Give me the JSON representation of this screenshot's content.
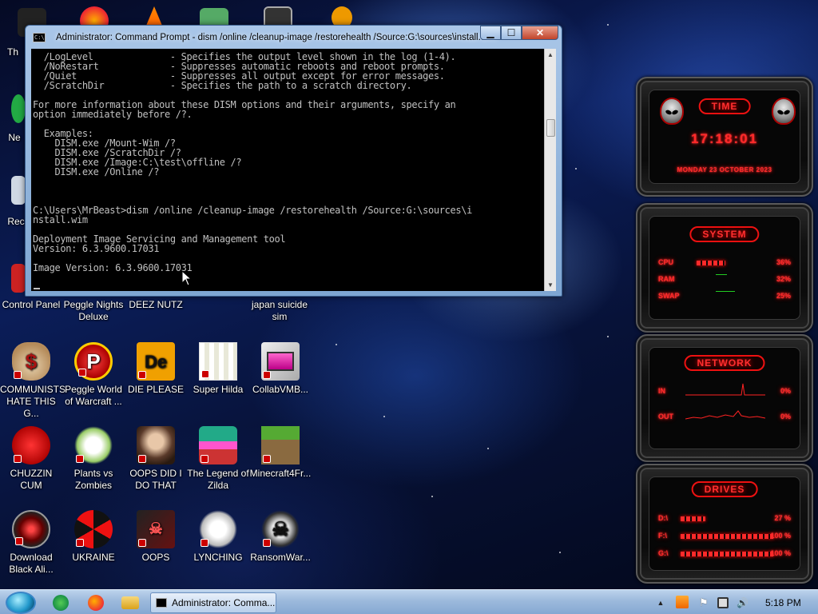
{
  "window": {
    "title": "Administrator: Command Prompt - dism  /online /cleanup-image /restorehealth /Source:G:\\sources\\install.wim",
    "console_lines": [
      "  /LogLevel              - Specifies the output level shown in the log (1-4).",
      "  /NoRestart             - Suppresses automatic reboots and reboot prompts.",
      "  /Quiet                 - Suppresses all output except for error messages.",
      "  /ScratchDir            - Specifies the path to a scratch directory.",
      "",
      "For more information about these DISM options and their arguments, specify an",
      "option immediately before /?.",
      "",
      "  Examples:",
      "    DISM.exe /Mount-Wim /?",
      "    DISM.exe /ScratchDir /?",
      "    DISM.exe /Image:C:\\test\\offline /?",
      "    DISM.exe /Online /?",
      "",
      "",
      "",
      "C:\\Users\\MrBeast>dism /online /cleanup-image /restorehealth /Source:G:\\sources\\i",
      "nstall.wim",
      "",
      "Deployment Image Servicing and Management tool",
      "Version: 6.3.9600.17031",
      "",
      "Image Version: 6.3.9600.17031"
    ]
  },
  "desktop": {
    "partial_labels": {
      "top_left": "Th",
      "ne": "Ne",
      "re": "Rec"
    },
    "icons": [
      {
        "label": "Control Panel",
        "icon": "control-panel-icon"
      },
      {
        "label": "Peggle Nights Deluxe",
        "icon": "peggle-nights-icon"
      },
      {
        "label": "DEEZ NUTZ",
        "icon": "deez-nutz-icon"
      },
      {
        "label": "japan suicide sim",
        "icon": "japan-sim-icon"
      },
      {
        "label": "COMMUNISTS HATE THIS G...",
        "icon": "money-bag-icon"
      },
      {
        "label": "Peggle World of Warcraft ...",
        "icon": "peggle-wow-icon"
      },
      {
        "label": "DIE PLEASE",
        "icon": "die-please-icon"
      },
      {
        "label": "Super Hilda",
        "icon": "super-hilda-icon"
      },
      {
        "label": "CollabVMB...",
        "icon": "collabvm-icon"
      },
      {
        "label": "CHUZZIN CUM",
        "icon": "chuzzle-icon"
      },
      {
        "label": "Plants vs Zombies",
        "icon": "plants-vs-zombies-icon"
      },
      {
        "label": "OOPS DID I DO THAT",
        "icon": "portrait-icon"
      },
      {
        "label": "The Legend of Zilda",
        "icon": "zilda-icon"
      },
      {
        "label": "Minecraft4Fr...",
        "icon": "minecraft-icon"
      },
      {
        "label": "Download Black Ali...",
        "icon": "black-alien-icon"
      },
      {
        "label": "UKRAINE",
        "icon": "radiation-icon"
      },
      {
        "label": "OOPS",
        "icon": "oops-icon"
      },
      {
        "label": "LYNCHING",
        "icon": "lynching-icon"
      },
      {
        "label": "RansomWar...",
        "icon": "skull-icon"
      }
    ]
  },
  "gadgets": {
    "time": {
      "label": "TIME",
      "clock": "17:18:01",
      "date": "MONDAY 23 OCTOBER 2023"
    },
    "system": {
      "label": "SYSTEM",
      "rows": [
        {
          "name": "CPU",
          "value": "36%",
          "level": 0.36
        },
        {
          "name": "RAM",
          "value": "32%",
          "level": 0.32
        },
        {
          "name": "SWAP",
          "value": "25%",
          "level": 0.25
        }
      ]
    },
    "network": {
      "label": "NETWORK",
      "rows": [
        {
          "name": "IN",
          "value": "0%"
        },
        {
          "name": "OUT",
          "value": "0%"
        }
      ]
    },
    "drives": {
      "label": "DRIVES",
      "rows": [
        {
          "name": "D:\\",
          "value": "27 %",
          "level": 0.27
        },
        {
          "name": "F:\\",
          "value": "100 %",
          "level": 1.0
        },
        {
          "name": "G:\\",
          "value": "100 %",
          "level": 1.0
        }
      ]
    }
  },
  "taskbar": {
    "task_label": "Administrator: Comma...",
    "clock": "5:18 PM"
  },
  "colors": {
    "accent_red": "#ff2a2a",
    "taskbar": "#9cb9dc",
    "console_text": "#c0c0c0"
  }
}
